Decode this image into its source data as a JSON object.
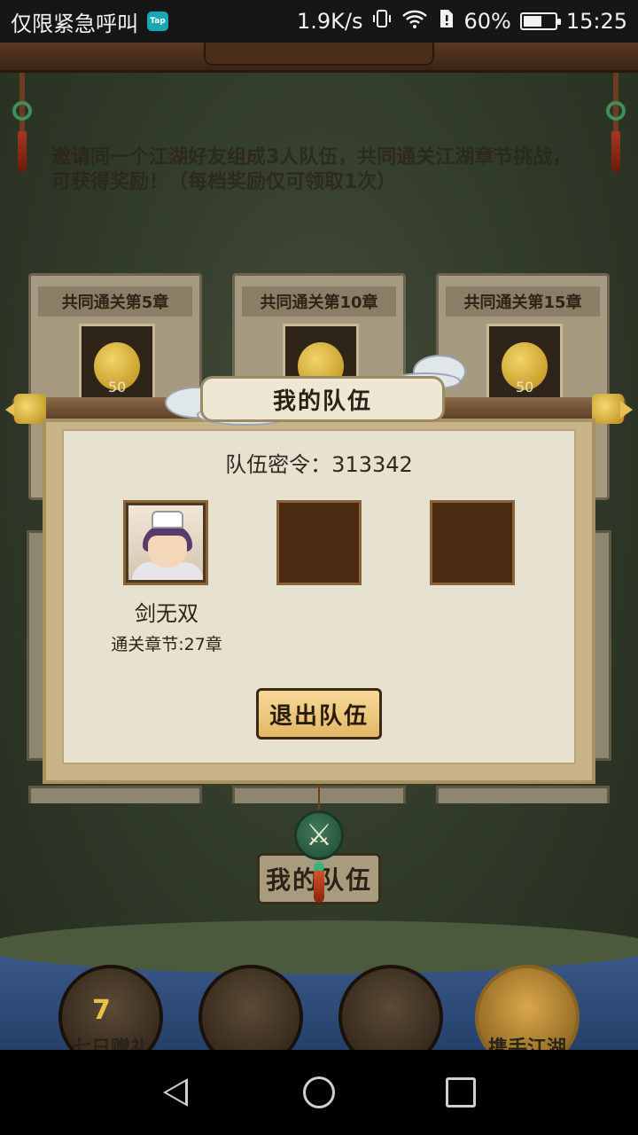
{
  "status_bar": {
    "carrier_text": "仅限紧急呼叫",
    "app_badge": "Tap",
    "net_speed": "1.9K/s",
    "battery": "60%",
    "battery_level": 0.6,
    "time": "15:25"
  },
  "game": {
    "intro_text": "邀请同一个江湖好友组成3人队伍，共同通关江湖章节挑战，可获得奖励！（每档奖励仅可领取1次）",
    "reward_cards": [
      {
        "title": "共同通关第5章",
        "count": "50"
      },
      {
        "title": "共同通关第10章",
        "count": "50"
      },
      {
        "title": "共同通关第15章",
        "count": "50"
      }
    ],
    "my_team_button": "我的队伍",
    "dock": {
      "item1_label": "七日赠礼",
      "item1_number": "7",
      "item4_label": "携手江湖"
    }
  },
  "modal": {
    "title": "我的队伍",
    "team_code": "队伍密令：313342",
    "members": [
      {
        "name": "剑无双",
        "info": "通关章节:27章"
      }
    ],
    "exit_button": "退出队伍"
  },
  "colors": {
    "exit_button": "#e8c070",
    "slot_empty": "#4b2a12",
    "panel_bg": "#e7e1cf"
  }
}
